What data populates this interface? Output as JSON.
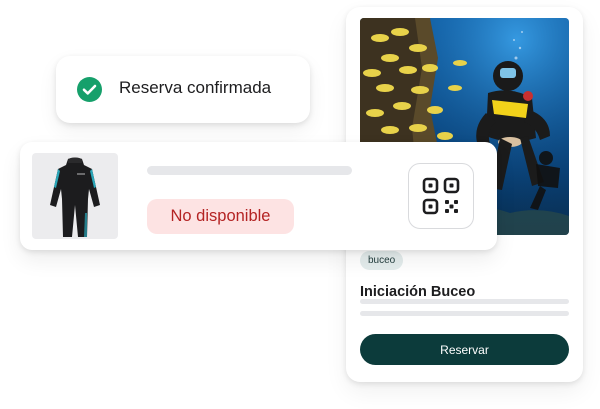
{
  "toast": {
    "icon": "check-circle-icon",
    "message": "Reserva confirmada",
    "color": "#16a06b"
  },
  "product": {
    "image": "wetsuit",
    "status": "No disponible",
    "status_color": "#b42323",
    "status_bg": "#fde3e3",
    "qr_icon": "qr-code-icon"
  },
  "activity": {
    "image": "scuba-diver-photo",
    "tag": "buceo",
    "title": "Iniciación Buceo",
    "cta": "Reservar",
    "cta_color": "#0c3b3b"
  }
}
